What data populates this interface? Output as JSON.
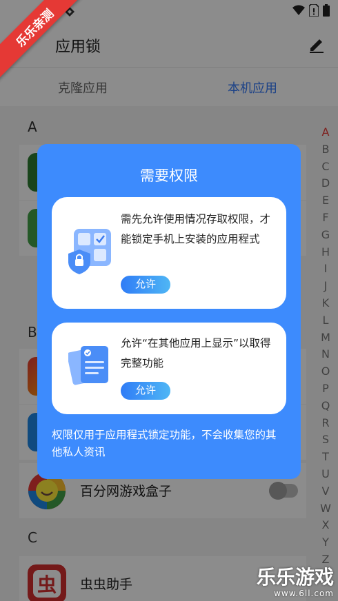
{
  "status_bar": {
    "icons": [
      "status-small-icon",
      "wifi-icon",
      "no-sim-icon",
      "battery-icon"
    ]
  },
  "app_bar": {
    "title": "应用锁",
    "edit_icon": "pencil-icon",
    "back_icon": "back-arrow-icon"
  },
  "tabs": [
    {
      "label": "克隆应用",
      "selected": false
    },
    {
      "label": "本机应用",
      "selected": true,
      "color": "#3478f6"
    }
  ],
  "sections": [
    {
      "letter": "A",
      "apps": [
        {
          "name": "",
          "icon": "green-app-icon"
        },
        {
          "name": "",
          "icon": "green-app-icon"
        }
      ]
    },
    {
      "letter": "B",
      "apps": [
        {
          "name": "",
          "icon": "game-app-icon"
        },
        {
          "name": "",
          "icon": "blue-app-icon"
        },
        {
          "name": "百分网游戏盒子",
          "icon": "baifen-game-icon",
          "toggle_on": false
        }
      ]
    },
    {
      "letter": "C",
      "apps": [
        {
          "name": "虫虫助手",
          "icon": "chongchong-icon"
        }
      ]
    }
  ],
  "alpha_index": [
    "A",
    "B",
    "C",
    "D",
    "E",
    "F",
    "G",
    "H",
    "I",
    "J",
    "K",
    "L",
    "M",
    "N",
    "O",
    "P",
    "Q",
    "R",
    "S",
    "T",
    "U",
    "V",
    "W",
    "X",
    "Y",
    "Z"
  ],
  "alpha_index_active": "A",
  "dialog": {
    "title": "需要权限",
    "cards": [
      {
        "text": "需先允许使用情况存取权限，才能锁定手机上安装的应用程式",
        "button": "允许",
        "icon": "usage-access-icon"
      },
      {
        "text": "允许“在其他应用上显示”以取得完整功能",
        "button": "允许",
        "icon": "overlay-documents-icon"
      }
    ],
    "note": "权限仅用于应用程式锁定功能，不会收集您的其他私人资讯",
    "background_color": "#3d8bfd"
  },
  "watermarks": {
    "ribbon": "乐乐亲测",
    "brand": "乐乐游戏",
    "site": "www.6ll.com"
  },
  "colors": {
    "accent": "#3478f6",
    "index_active": "#e53935"
  }
}
